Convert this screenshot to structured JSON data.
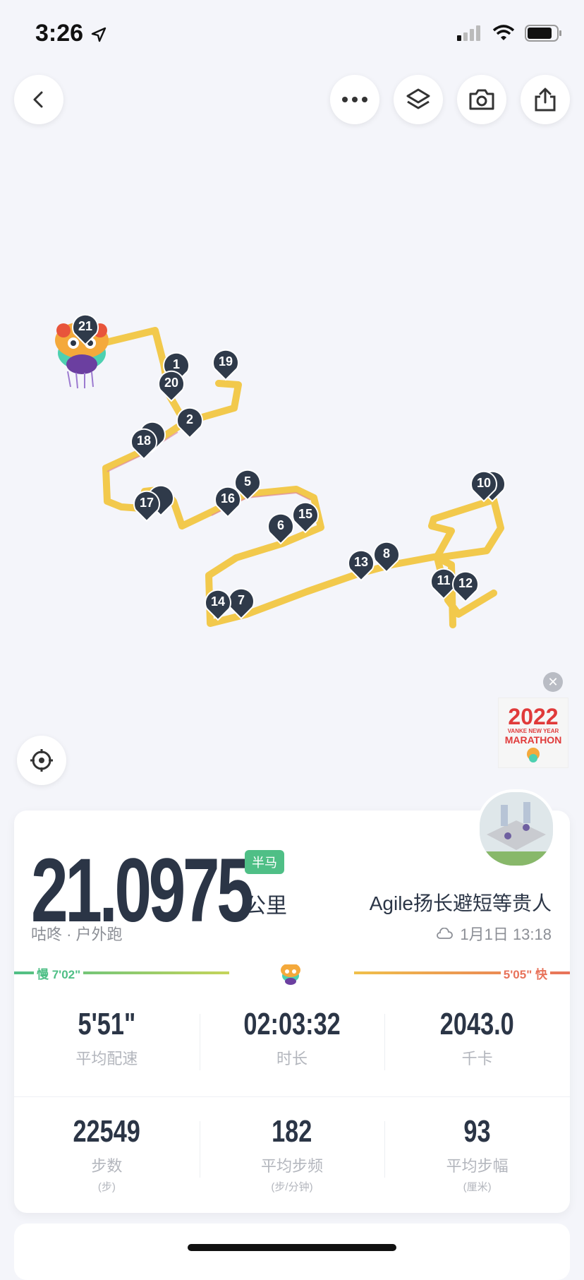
{
  "status_bar": {
    "time": "3:26"
  },
  "toolbar": {
    "back_icon": "chevron-left-icon",
    "more_icon": "ellipsis-icon",
    "layers_icon": "layers-icon",
    "camera_icon": "camera-icon",
    "share_icon": "share-icon"
  },
  "map": {
    "markers": [
      "1",
      "2",
      "3",
      "4",
      "5",
      "6",
      "7",
      "8",
      "9",
      "10",
      "11",
      "12",
      "13",
      "14",
      "15",
      "16",
      "17",
      "18",
      "19",
      "20",
      "21"
    ],
    "route_color": "#f2c94c",
    "marker_color": "#2f3a4a"
  },
  "promo": {
    "year": "2022",
    "line1": "VANKE NEW YEAR",
    "line2": "MARATHON"
  },
  "summary": {
    "distance": "21.0975",
    "badge": "半马",
    "unit": "公里",
    "source": "咕咚 · 户外跑",
    "username": "Agile扬长避短等贵人",
    "datetime": "1月1日 13:18"
  },
  "pace": {
    "slow_label": "慢 7'02\"",
    "fast_label": "5'05\" 快",
    "slow_color": "#4fbf86",
    "fast_color": "#e8725a"
  },
  "stats": [
    {
      "value": "5'51\"",
      "label": "平均配速",
      "sub": ""
    },
    {
      "value": "02:03:32",
      "label": "时长",
      "sub": ""
    },
    {
      "value": "2043.0",
      "label": "千卡",
      "sub": ""
    }
  ],
  "stats2": [
    {
      "value": "22549",
      "label": "步数",
      "sub": "(步)"
    },
    {
      "value": "182",
      "label": "平均步频",
      "sub": "(步/分钟)"
    },
    {
      "value": "93",
      "label": "平均步幅",
      "sub": "(厘米)"
    }
  ]
}
